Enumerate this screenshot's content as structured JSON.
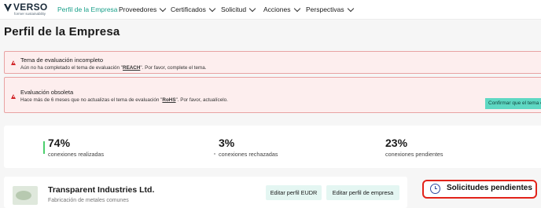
{
  "brand": {
    "name": "VERSO",
    "tagline": "former sustainability"
  },
  "nav": [
    {
      "label": "Perfil de la Empresa",
      "active": true,
      "has_menu": false
    },
    {
      "label": "Proveedores",
      "active": false,
      "has_menu": true
    },
    {
      "label": "Certificados",
      "active": false,
      "has_menu": true
    },
    {
      "label": "Solicitud",
      "active": false,
      "has_menu": true
    },
    {
      "label": "Acciones",
      "active": false,
      "has_menu": true
    },
    {
      "label": "Perspectivas",
      "active": false,
      "has_menu": true
    }
  ],
  "page": {
    "title": "Perfil de la Empresa"
  },
  "alerts": [
    {
      "title": "Tema de evaluación incompleto",
      "msg_pre": "Aún no ha completado el tema de evaluación \"",
      "topic": "REACH",
      "msg_post": "\". Por favor, complete el tema."
    },
    {
      "title": "Evaluación obsoleta",
      "msg_pre": "Hace más de 6 meses que no actualizas el tema de evaluación \"",
      "topic": "RoHS",
      "msg_post": "\". Por favor, actualícelo.",
      "action_label": "Confirmar que el tema está actualizado"
    }
  ],
  "stats": [
    {
      "value": "74%",
      "label": "conexiones realizadas"
    },
    {
      "value": "3%",
      "label": "conexiones rechazadas"
    },
    {
      "value": "23%",
      "label": "conexiones pendientes"
    }
  ],
  "company": {
    "name": "Transparent Industries Ltd.",
    "subtitle": "Fabricación de metales comunes",
    "edit_eudr_label": "Editar perfil EUDR",
    "edit_company_label": "Editar perfil de empresa"
  },
  "pending_requests": {
    "label": "Solicitudes pendientes"
  },
  "colors": {
    "accent": "#1aa08a",
    "alert_bg": "#fdeeee",
    "alert_border": "#e8a3a3",
    "warning": "#d2262a",
    "button_teal": "#5fd8c3",
    "highlight_red": "#e2231a"
  }
}
